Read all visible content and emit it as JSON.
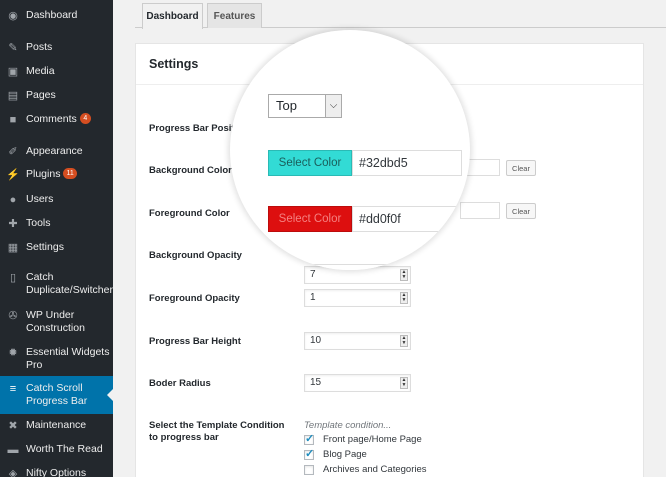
{
  "sidebar": {
    "items": [
      {
        "label": "Dashboard",
        "icon": "dashboard-icon",
        "glyph": "◉"
      },
      {
        "label": "Posts",
        "icon": "pushpin-icon",
        "glyph": "✎"
      },
      {
        "label": "Media",
        "icon": "media-icon",
        "glyph": "▣"
      },
      {
        "label": "Pages",
        "icon": "pages-icon",
        "glyph": "▤"
      },
      {
        "label": "Comments",
        "icon": "comments-icon",
        "glyph": "■",
        "badge": "4"
      },
      {
        "label": "Appearance",
        "icon": "paintbrush-icon",
        "glyph": "✐"
      },
      {
        "label": "Plugins",
        "icon": "plugins-icon",
        "glyph": "⚡",
        "badge": "11"
      },
      {
        "label": "Users",
        "icon": "users-icon",
        "glyph": "●"
      },
      {
        "label": "Tools",
        "icon": "tools-icon",
        "glyph": "✚"
      },
      {
        "label": "Settings",
        "icon": "settings-icon",
        "glyph": "▦"
      },
      {
        "label": "Catch\nDuplicate/Switcher",
        "icon": "duplicate-icon",
        "glyph": "▯"
      },
      {
        "label": "WP Under\nConstruction",
        "icon": "wrench-icon",
        "glyph": "✇"
      },
      {
        "label": "Essential Widgets\nPro",
        "icon": "gear-icon",
        "glyph": "✹"
      },
      {
        "label": "Catch Scroll\nProgress Bar",
        "icon": "progress-bar-icon",
        "glyph": "≡",
        "active": true
      },
      {
        "label": "Maintenance",
        "icon": "maintenance-icon",
        "glyph": "✖"
      },
      {
        "label": "Worth The Read",
        "icon": "worth-the-read-icon",
        "glyph": "▬"
      },
      {
        "label": "Nifty Options",
        "icon": "nifty-options-icon",
        "glyph": "◈"
      }
    ]
  },
  "tabs": [
    {
      "label": "Dashboard",
      "active": true
    },
    {
      "label": "Features",
      "active": false
    }
  ],
  "panel": {
    "title": "Settings",
    "labels": {
      "position": "Progress Bar Position",
      "bg_color": "Background Color",
      "fg_color": "Foreground Color",
      "bg_opacity": "Background Opacity",
      "fg_opacity": "Foreground Opacity",
      "height": "Progress Bar Height",
      "radius": "Boder Radius",
      "template": "Select the Template Condition\nto progress bar"
    },
    "position_value": "Top",
    "bg_color_btn": "Select Color",
    "bg_color_hex": "#32dbd5",
    "fg_color_btn": "Select Color",
    "fg_color_hex": "#dd0f0f",
    "clear_label": "Clear",
    "bg_opacity_value": "7",
    "fg_opacity_value": "1",
    "height_value": "10",
    "radius_value": "15",
    "template_placeholder": "Template condition...",
    "template_options": [
      {
        "label": "Front page/Home Page",
        "checked": true
      },
      {
        "label": "Blog Page",
        "checked": true
      },
      {
        "label": "Archives and Categories",
        "checked": false
      }
    ]
  },
  "colors": {
    "bg_color": "#32dbd5",
    "fg_color": "#dd0f0f",
    "sidebar": "#23282d",
    "active": "#0073aa"
  }
}
